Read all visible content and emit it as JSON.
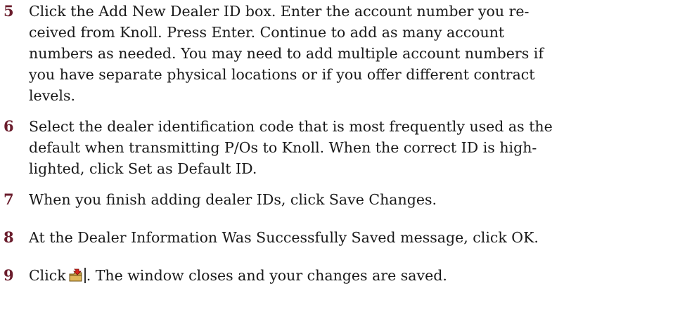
{
  "steps": [
    {
      "number": "5",
      "lines": [
        "Click the Add New Dealer ID box. Enter the account number you re-",
        "ceived from Knoll. Press Enter. Continue to add as many account",
        "numbers as needed. You may need to add multiple account numbers if",
        "you have separate physical locations or if you offer different contract",
        "levels."
      ]
    },
    {
      "number": "6",
      "lines": [
        "Select the dealer identification code that is most frequently used as the",
        "default when transmitting P/Os to Knoll. When the correct ID is high-",
        "lighted, click Set as Default ID."
      ]
    },
    {
      "number": "7",
      "lines": [
        "When you finish adding dealer IDs, click Save Changes."
      ]
    },
    {
      "number": "8",
      "lines": [
        "At the Dealer Information Was Successfully Saved message, click OK."
      ]
    },
    {
      "number": "9",
      "before_icon": "Click",
      "icon": "close-window-icon",
      "after_icon": ". The window closes and your changes are saved."
    }
  ]
}
